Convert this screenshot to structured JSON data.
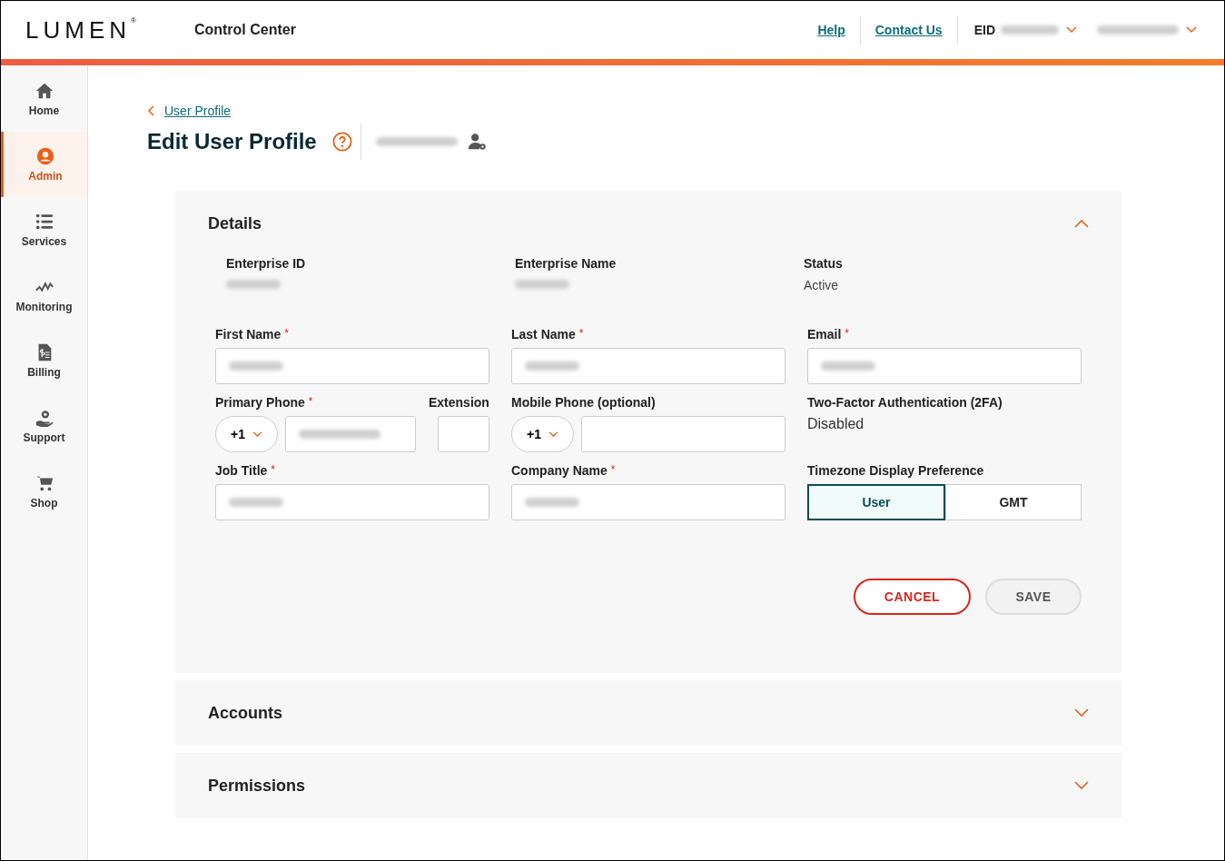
{
  "header": {
    "logo": "LUMEN",
    "logo_mark": "®",
    "app_title": "Control Center",
    "links": [
      "Help",
      "Contact Us"
    ],
    "eid_label": "EID",
    "eid_redacted": true,
    "user_redacted": true
  },
  "sidebar": {
    "items": [
      {
        "label": "Home",
        "selected": false
      },
      {
        "label": "Admin",
        "selected": true
      },
      {
        "label": "Services",
        "selected": false
      },
      {
        "label": "Monitoring",
        "selected": false
      },
      {
        "label": "Billing",
        "selected": false
      },
      {
        "label": "Support",
        "selected": false
      },
      {
        "label": "Shop",
        "selected": false
      }
    ]
  },
  "breadcrumb": "User Profile",
  "title": "Edit User Profile",
  "user_name_redacted": true,
  "sections": [
    {
      "title": "Details",
      "expanded": true
    },
    {
      "title": "Accounts",
      "expanded": false
    },
    {
      "title": "Permissions",
      "expanded": false
    }
  ],
  "details": {
    "info": [
      {
        "label": "Enterprise ID",
        "redacted": true
      },
      {
        "label": "Enterprise Name",
        "redacted": true
      },
      {
        "label": "Status",
        "value": "Active"
      }
    ],
    "fields": [
      {
        "kind": "text",
        "label": "First Name",
        "required_mark": "*",
        "redacted": true
      },
      {
        "kind": "text",
        "label": "Last Name",
        "required_mark": "*",
        "redacted": true
      },
      {
        "kind": "text",
        "label": "Email",
        "required_mark": "*",
        "redacted": true
      },
      {
        "kind": "phone",
        "label": "Primary Phone",
        "required_mark": "*",
        "code": "+1",
        "redacted": true,
        "extension_label": "Extension"
      },
      {
        "kind": "phone",
        "label": "Mobile Phone (optional)",
        "code": "+1"
      },
      {
        "kind": "readonly",
        "label": "Two-Factor Authentication (2FA)",
        "value": "Disabled"
      },
      {
        "kind": "text",
        "label": "Job Title",
        "required_mark": "*",
        "redacted": true
      },
      {
        "kind": "text",
        "label": "Company Name",
        "required_mark": "*",
        "redacted": true
      },
      {
        "kind": "toggle",
        "label": "Timezone Display Preference",
        "options": [
          {
            "label": "User",
            "selected": true
          },
          {
            "label": "GMT",
            "selected": false
          }
        ]
      }
    ],
    "buttons": [
      {
        "label": "CANCEL",
        "kind": "cancel"
      },
      {
        "label": "SAVE",
        "kind": "save"
      }
    ]
  }
}
